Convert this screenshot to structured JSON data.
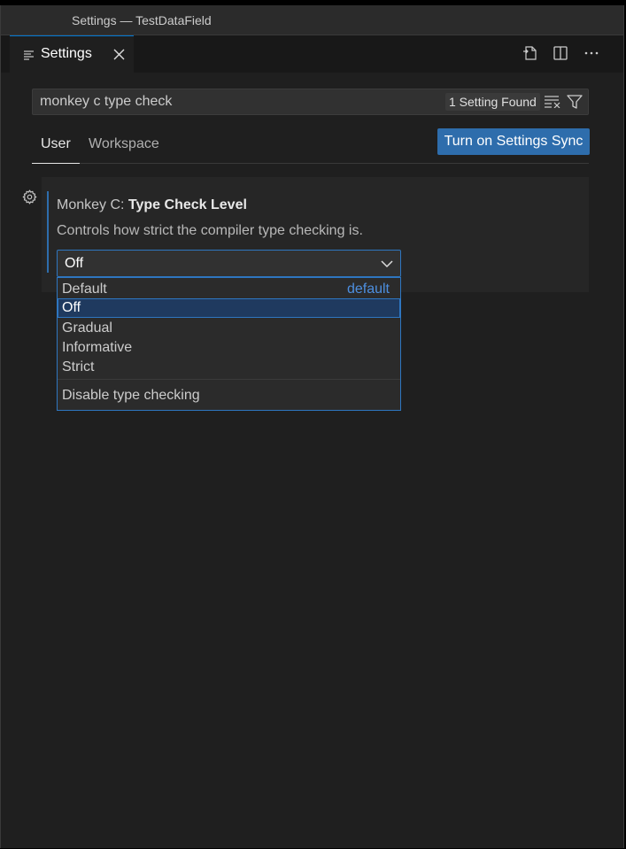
{
  "window": {
    "title": "Settings — TestDataField"
  },
  "tab": {
    "label": "Settings"
  },
  "search": {
    "value": "monkey c type check",
    "results_badge": "1 Setting Found"
  },
  "scopes": {
    "user": "User",
    "workspace": "Workspace"
  },
  "sync_button": "Turn on Settings Sync",
  "setting": {
    "category": "Monkey C: ",
    "name": "Type Check Level",
    "description": "Controls how strict the compiler type checking is.",
    "selected_value": "Off"
  },
  "dropdown": {
    "options": [
      {
        "label": "Default",
        "hint": "default"
      },
      {
        "label": "Off"
      },
      {
        "label": "Gradual"
      },
      {
        "label": "Informative"
      },
      {
        "label": "Strict"
      }
    ],
    "selected_option": "Off",
    "option_description": "Disable type checking"
  },
  "colors": {
    "accent": "#2e6dac",
    "focus_border": "#2e76c0",
    "link": "#4d8fe0"
  }
}
